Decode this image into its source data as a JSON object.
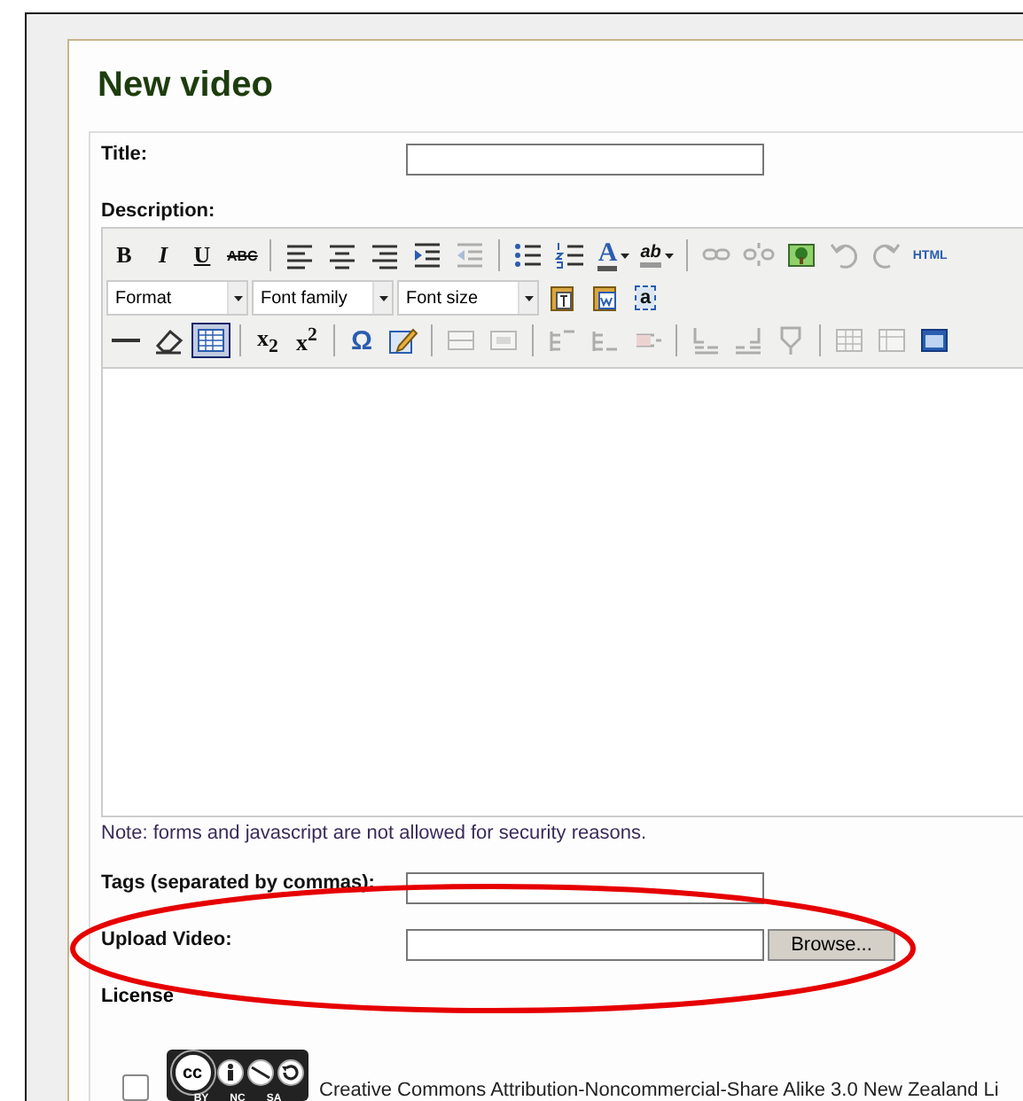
{
  "heading": "New video",
  "title_field": {
    "label": "Title:"
  },
  "description": {
    "label": "Description:",
    "toolbar": [
      {
        "items": [
          {
            "kind": "button",
            "label": "B",
            "disabled": false
          },
          {
            "kind": "button",
            "label": "I",
            "disabled": false
          },
          {
            "kind": "button",
            "label": "U",
            "disabled": false
          },
          {
            "kind": "button",
            "label": "ABC",
            "disabled": false
          },
          {
            "kind": "separator"
          },
          {
            "kind": "button",
            "disabled": false
          },
          {
            "kind": "button",
            "disabled": false
          },
          {
            "kind": "button",
            "disabled": false
          },
          {
            "kind": "button",
            "disabled": false
          },
          {
            "kind": "button",
            "disabled": true
          },
          {
            "kind": "separator"
          },
          {
            "kind": "button",
            "disabled": false
          },
          {
            "kind": "button",
            "disabled": false
          },
          {
            "kind": "split",
            "label": "A",
            "disabled": false
          },
          {
            "kind": "split",
            "label": "ab",
            "disabled": false
          },
          {
            "kind": "separator"
          },
          {
            "kind": "button",
            "disabled": true
          },
          {
            "kind": "button",
            "disabled": true
          },
          {
            "kind": "button",
            "disabled": false
          },
          {
            "kind": "button",
            "disabled": true
          },
          {
            "kind": "button",
            "disabled": true
          },
          {
            "kind": "button",
            "label": "HTML",
            "disabled": false
          }
        ]
      },
      {
        "items": [
          {
            "kind": "select",
            "label": "Format"
          },
          {
            "kind": "select",
            "label": "Font family"
          },
          {
            "kind": "select",
            "label": "Font size"
          },
          {
            "kind": "button",
            "disabled": false
          },
          {
            "kind": "button",
            "disabled": false
          },
          {
            "kind": "button",
            "label": "a",
            "disabled": false
          }
        ]
      },
      {
        "items": [
          {
            "kind": "button",
            "disabled": false
          },
          {
            "kind": "button",
            "disabled": false
          },
          {
            "kind": "button",
            "disabled": false,
            "selected": true
          },
          {
            "kind": "separator"
          },
          {
            "kind": "button",
            "label": "x$_{2}$",
            "disabled": false
          },
          {
            "kind": "button",
            "label": "x$^{2}$",
            "disabled": false
          },
          {
            "kind": "separator"
          },
          {
            "kind": "button",
            "label": "Ω",
            "disabled": false
          },
          {
            "kind": "button",
            "disabled": false
          },
          {
            "kind": "separator"
          },
          {
            "kind": "button",
            "disabled": true
          },
          {
            "kind": "button",
            "disabled": true
          },
          {
            "kind": "separator"
          },
          {
            "kind": "button",
            "disabled": true
          },
          {
            "kind": "button",
            "disabled": true
          },
          {
            "kind": "button",
            "disabled": true
          },
          {
            "kind": "separator"
          },
          {
            "kind": "button",
            "disabled": true
          },
          {
            "kind": "button",
            "disabled": true
          },
          {
            "kind": "button",
            "disabled": true
          },
          {
            "kind": "separator"
          },
          {
            "kind": "button",
            "disabled": true
          },
          {
            "kind": "button",
            "disabled": true
          },
          {
            "kind": "button",
            "disabled": false
          }
        ]
      }
    ],
    "note": "Note: forms and javascript are not allowed for security reasons."
  },
  "tags_field": {
    "label": "Tags (separated by commas):"
  },
  "upload_field": {
    "label": "Upload Video:",
    "button": "Browse..."
  },
  "license": {
    "label": "License",
    "options": [
      {
        "badge": "cc",
        "badge_terms": [
          "BY",
          "NC",
          "SA"
        ],
        "text": "Creative Commons Attribution-Noncommercial-Share Alike 3.0 New Zealand Li",
        "selected": false
      }
    ]
  }
}
